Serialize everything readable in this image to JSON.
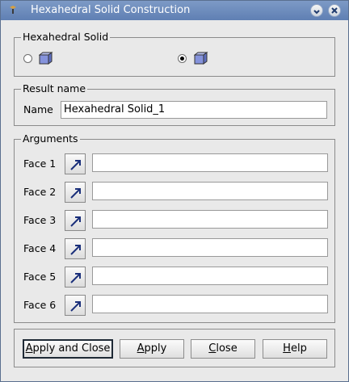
{
  "window": {
    "title": "Hexahedral Solid Construction"
  },
  "constructor": {
    "group_title": "Hexahedral Solid",
    "selected_option": 2
  },
  "result": {
    "group_title": "Result name",
    "name_label": "Name",
    "name_value": "Hexahedral Solid_1"
  },
  "arguments": {
    "group_title": "Arguments",
    "faces": [
      {
        "label": "Face 1",
        "value": ""
      },
      {
        "label": "Face 2",
        "value": ""
      },
      {
        "label": "Face 3",
        "value": ""
      },
      {
        "label": "Face 4",
        "value": ""
      },
      {
        "label": "Face 5",
        "value": ""
      },
      {
        "label": "Face 6",
        "value": ""
      }
    ]
  },
  "buttons": {
    "apply_and_close": {
      "underline": "A",
      "rest": "pply and Close"
    },
    "apply": {
      "underline": "A",
      "rest": "pply"
    },
    "close": {
      "underline": "C",
      "rest": "lose"
    },
    "help": {
      "underline": "H",
      "rest": "elp"
    }
  },
  "icons": {
    "app": "app-icon",
    "minimize": "minimize-icon",
    "close": "close-icon",
    "hex_by_faces": "hexahedron-by-faces-icon",
    "hex_by_quads": "hexahedron-by-quadrangles-icon",
    "select": "select-arrow-icon"
  },
  "colors": {
    "titlebar": "#6a88bb",
    "cube_face": "#7f8fd8"
  }
}
